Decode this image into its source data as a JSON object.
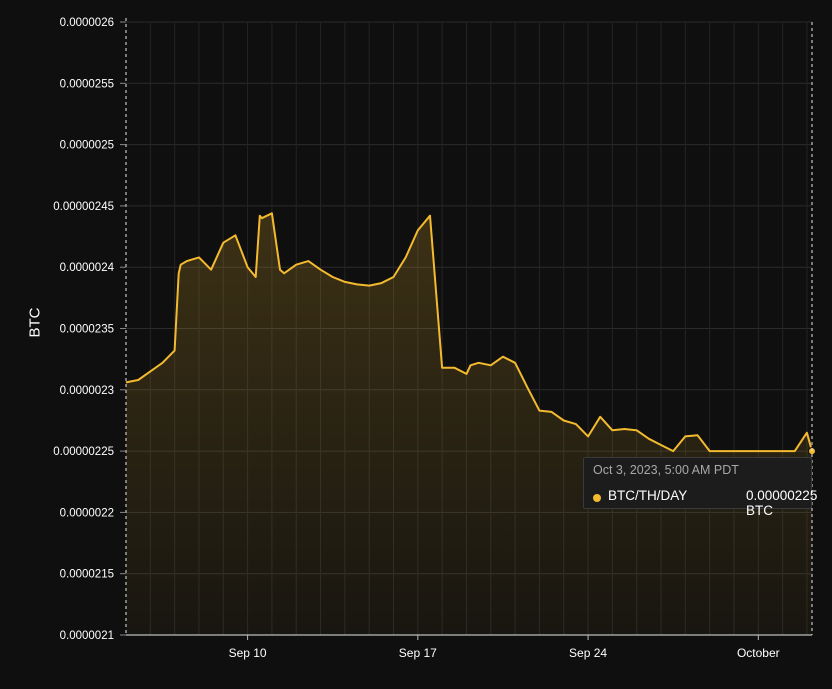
{
  "chart_data": {
    "type": "area",
    "ylabel": "BTC",
    "xlabel": "",
    "ylim": [
      2.1e-06,
      2.6e-06
    ],
    "y_ticks": [
      "0.0000026",
      "0.0000255",
      "0.0000025",
      "0.00000245",
      "0.0000024",
      "0.0000235",
      "0.0000023",
      "0.00000225",
      "0.0000022",
      "0.0000215",
      "0.0000021"
    ],
    "x_ticks": [
      "Sep 10",
      "Sep 17",
      "Sep 24",
      "October"
    ],
    "grid": true,
    "color": "#f3ba2f",
    "series": [
      {
        "name": "BTC/TH/DAY",
        "x": [
          "2023-09-05T00:00",
          "2023-09-05T12:00",
          "2023-09-06T00:00",
          "2023-09-06T12:00",
          "2023-09-07T00:00",
          "2023-09-07T04:00",
          "2023-09-07T06:00",
          "2023-09-07T12:00",
          "2023-09-08T00:00",
          "2023-09-08T12:00",
          "2023-09-09T00:00",
          "2023-09-09T12:00",
          "2023-09-10T00:00",
          "2023-09-10T08:00",
          "2023-09-10T12:00",
          "2023-09-10T14:00",
          "2023-09-11T00:00",
          "2023-09-11T08:00",
          "2023-09-11T12:00",
          "2023-09-12T00:00",
          "2023-09-12T12:00",
          "2023-09-13T00:00",
          "2023-09-13T12:00",
          "2023-09-14T00:00",
          "2023-09-14T12:00",
          "2023-09-15T00:00",
          "2023-09-15T12:00",
          "2023-09-16T00:00",
          "2023-09-16T12:00",
          "2023-09-17T00:00",
          "2023-09-17T12:00",
          "2023-09-18T00:00",
          "2023-09-18T12:00",
          "2023-09-19T00:00",
          "2023-09-19T04:00",
          "2023-09-19T12:00",
          "2023-09-20T00:00",
          "2023-09-20T12:00",
          "2023-09-21T00:00",
          "2023-09-21T12:00",
          "2023-09-22T00:00",
          "2023-09-22T12:00",
          "2023-09-23T00:00",
          "2023-09-23T12:00",
          "2023-09-24T00:00",
          "2023-09-24T12:00",
          "2023-09-25T00:00",
          "2023-09-25T12:00",
          "2023-09-26T00:00",
          "2023-09-26T12:00",
          "2023-09-27T00:00",
          "2023-09-27T12:00",
          "2023-09-28T00:00",
          "2023-09-28T12:00",
          "2023-09-29T00:00",
          "2023-09-29T12:00",
          "2023-09-30T00:00",
          "2023-09-30T12:00",
          "2023-10-01T00:00",
          "2023-10-01T12:00",
          "2023-10-02T00:00",
          "2023-10-02T12:00",
          "2023-10-03T00:00",
          "2023-10-03T05:00"
        ],
        "values": [
          2.306e-06,
          2.308e-06,
          2.315e-06,
          2.322e-06,
          2.332e-06,
          2.395e-06,
          2.402e-06,
          2.405e-06,
          2.408e-06,
          2.398e-06,
          2.42e-06,
          2.426e-06,
          2.4e-06,
          2.392e-06,
          2.442e-06,
          2.44e-06,
          2.444e-06,
          2.398e-06,
          2.395e-06,
          2.402e-06,
          2.405e-06,
          2.398e-06,
          2.392e-06,
          2.388e-06,
          2.386e-06,
          2.385e-06,
          2.387e-06,
          2.392e-06,
          2.408e-06,
          2.43e-06,
          2.442e-06,
          2.318e-06,
          2.318e-06,
          2.313e-06,
          2.32e-06,
          2.322e-06,
          2.32e-06,
          2.327e-06,
          2.322e-06,
          2.302e-06,
          2.283e-06,
          2.282e-06,
          2.275e-06,
          2.272e-06,
          2.262e-06,
          2.278e-06,
          2.267e-06,
          2.268e-06,
          2.267e-06,
          2.26e-06,
          2.255e-06,
          2.25e-06,
          2.262e-06,
          2.263e-06,
          2.25e-06,
          2.25e-06,
          2.25e-06,
          2.25e-06,
          2.25e-06,
          2.25e-06,
          2.25e-06,
          2.25e-06,
          2.265e-06,
          2.25e-06
        ]
      }
    ]
  },
  "tooltip": {
    "time": "Oct 3, 2023, 5:00 AM PDT",
    "series": "BTC/TH/DAY",
    "value": "0.00000225 BTC"
  }
}
